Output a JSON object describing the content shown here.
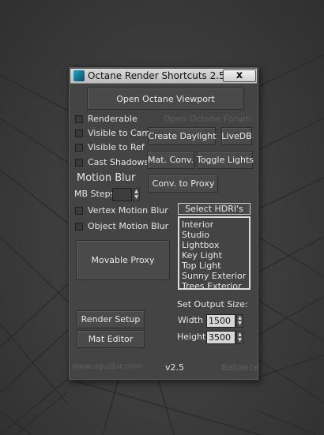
{
  "window": {
    "title": "Octane Render Shortcuts 2.5",
    "close_label": "x"
  },
  "buttons": {
    "open_viewport": "Open Octane Viewport",
    "create_daylight": "Create Daylight",
    "livedb": "LiveDB",
    "mat_conv": "Mat. Conv.",
    "toggle_lights": "Toggle Lights",
    "conv_proxy": "Conv. to Proxy",
    "select_hdri": "Select HDRI's",
    "movable_proxy": "Movable Proxy",
    "render_setup": "Render Setup",
    "mat_editor": "Mat Editor"
  },
  "forum_link": "Open Octane Forum",
  "checkboxes": {
    "renderable": "Renderable",
    "visible_cam": "Visible to Cam",
    "visible_ref": "Visible to Ref",
    "cast_shadows": "Cast Shadows",
    "vertex_mb": "Vertex Motion Blur",
    "object_mb": "Object Motion Blur"
  },
  "motion_blur": {
    "heading": "Motion Blur",
    "steps_label": "MB Steps",
    "steps_value": ""
  },
  "hdri_list": [
    "Interior",
    "Studio",
    "Lightbox",
    "Key Light",
    "Top Light",
    "Sunny Exterior",
    "Trees Exterior"
  ],
  "output": {
    "heading": "Set Output Size:",
    "width_label": "Width",
    "width_value": "1500",
    "height_label": "Height",
    "height_value": "3500"
  },
  "footer": {
    "website": "www.oguzbir.com",
    "version": "v2.5",
    "behance": "Behance"
  },
  "colors": {
    "panel": "#444444",
    "accent_icon": "#1ea8c8",
    "dim_text": "#5e5e5e"
  }
}
